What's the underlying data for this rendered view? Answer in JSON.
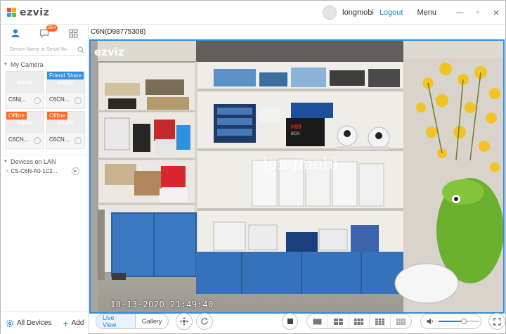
{
  "titlebar": {
    "logo_text": "ezviz",
    "username": "longmobi",
    "logout": "Logout",
    "menu": "Menu",
    "minimize": "—",
    "maximize": "▫",
    "close": "✕"
  },
  "sidebar": {
    "tabs": [
      {
        "name": "user-icon"
      },
      {
        "name": "message-icon",
        "badge": "99+"
      },
      {
        "name": "grid-icon"
      }
    ],
    "search_placeholder": "Device Name or Serial No.",
    "my_camera": {
      "title": "My Camera",
      "devices": [
        {
          "name": "C6N(...",
          "tag": ""
        },
        {
          "name": "C6CN...",
          "tag": "Friend Share"
        },
        {
          "name": "C6CN...",
          "tag": "Offline"
        },
        {
          "name": "C6CN...",
          "tag": "Offline"
        }
      ]
    },
    "lan": {
      "title": "Devices on LAN",
      "device": "CS-C6N-A0-1C2..."
    },
    "footer": {
      "all_devices": "All Devices",
      "add": "Add"
    }
  },
  "main": {
    "camera_title": "C6N(D98775308)",
    "watermark": "longmobi",
    "osd_logo": "ezviz",
    "timestamp": "10-13-2020 21:49:40",
    "box_label": "H99 BOX"
  },
  "controls": {
    "live_view": "Live View",
    "gallery": "Gallery",
    "volume_level": 0.62
  },
  "colors": {
    "accent": "#1a86d6",
    "video_border": "#2f8fe0",
    "badge": "#ff6a21",
    "friend_share": "#2f8fe0",
    "offline": "#ff6a21"
  }
}
